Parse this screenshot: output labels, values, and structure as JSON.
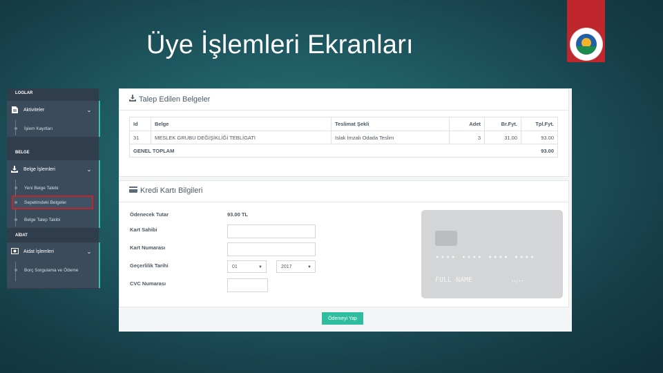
{
  "slide": {
    "title": "Üye İşlemleri Ekranları"
  },
  "sidebar": {
    "sections": [
      {
        "label": "LOGLAR"
      },
      {
        "label": "BELGE"
      },
      {
        "label": "AİDAT"
      }
    ],
    "groups": [
      {
        "label": "Aktiviteler",
        "icon": "file-icon",
        "items": [
          "İşlem Kayıtları"
        ]
      },
      {
        "label": "Belge İşlemleri",
        "icon": "download-icon",
        "items": [
          "Yeni Belge Talebi",
          "Sepetimdeki Belgeler",
          "Belge Talep Takibi"
        ],
        "active": "Sepetimdeki Belgeler"
      },
      {
        "label": "Aidat İşlemleri",
        "icon": "money-icon",
        "items": [
          "Borç Sorgulama ve Ödeme"
        ]
      }
    ]
  },
  "requests": {
    "title": "Talep Edilen Belgeler",
    "columns": [
      "Id",
      "Belge",
      "Teslimat Şekli",
      "Adet",
      "Br.Fyt.",
      "Tpl.Fyt."
    ],
    "rows": [
      {
        "id": "31",
        "belge": "MESLEK GRUBU DEĞİŞİKLİĞİ TEBLİGATI",
        "teslimat": "Islak İmzalı Odada Teslim",
        "adet": "3",
        "br": "31.00",
        "tpl": "93.00"
      }
    ],
    "total_label": "GENEL TOPLAM",
    "total_value": "93.00"
  },
  "card": {
    "title": "Kredi Kartı Bilgileri",
    "amount_label": "Ödenecek Tutar",
    "amount_value": "93.00 TL",
    "holder_label": "Kart Sahibi",
    "number_label": "Kart Numarası",
    "expiry_label": "Geçerlilik Tarihi",
    "month": "01",
    "year": "2017",
    "cvc_label": "CVC Numarası",
    "preview": {
      "number": "•••• •••• •••• ••••",
      "name": "FULL NAME",
      "expiry": "••/••"
    }
  },
  "pay_button": "Ödemeyi Yap",
  "colors": {
    "accent": "#2fbda0",
    "sidebar": "#2f3d4c",
    "logo_tab": "#c0272d",
    "active_outline": "#c0272d"
  }
}
